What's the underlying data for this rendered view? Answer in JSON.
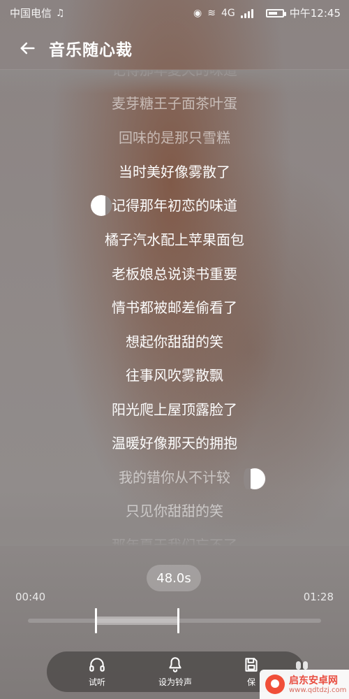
{
  "status_bar": {
    "carrier": "中国电信",
    "music_icon": "music-note-icon",
    "network": "4G",
    "time": "中午12:45"
  },
  "header": {
    "back_icon": "arrow-left-icon",
    "title": "音乐随心裁"
  },
  "lyrics": {
    "lines": [
      "记得那年夏天的味道",
      "麦芽糖王子面茶叶蛋",
      "回味的是那只雪糕",
      "当时美好像雾散了",
      "记得那年初恋的味道",
      "橘子汽水配上苹果面包",
      "老板娘总说读书重要",
      "情书都被邮差偷看了",
      "想起你甜甜的笑",
      "往事风吹雾散飘",
      "阳光爬上屋顶露脸了",
      "温暖好像那天的拥抱",
      "我的错你从不计较",
      "只见你甜甜的笑",
      "那年夏天我们忘不了"
    ]
  },
  "selection": {
    "duration": "48.0s",
    "start_time": "00:40",
    "end_time": "01:28",
    "start_fraction": 0.233,
    "end_fraction": 0.512
  },
  "toolbar": {
    "listen_icon": "headphones-icon",
    "listen_label": "试听",
    "ringtone_icon": "bell-icon",
    "ringtone_label": "设为铃声",
    "save_icon": "save-icon",
    "save_label": "保"
  },
  "watermark": {
    "title": "启东安卓网",
    "url": "www.qdtdzj.com"
  },
  "colors": {
    "text": "#ffffff",
    "dim_text": "#d8d2d0",
    "accent": "#f04f39",
    "toolbar_bg": "#4a4746"
  }
}
